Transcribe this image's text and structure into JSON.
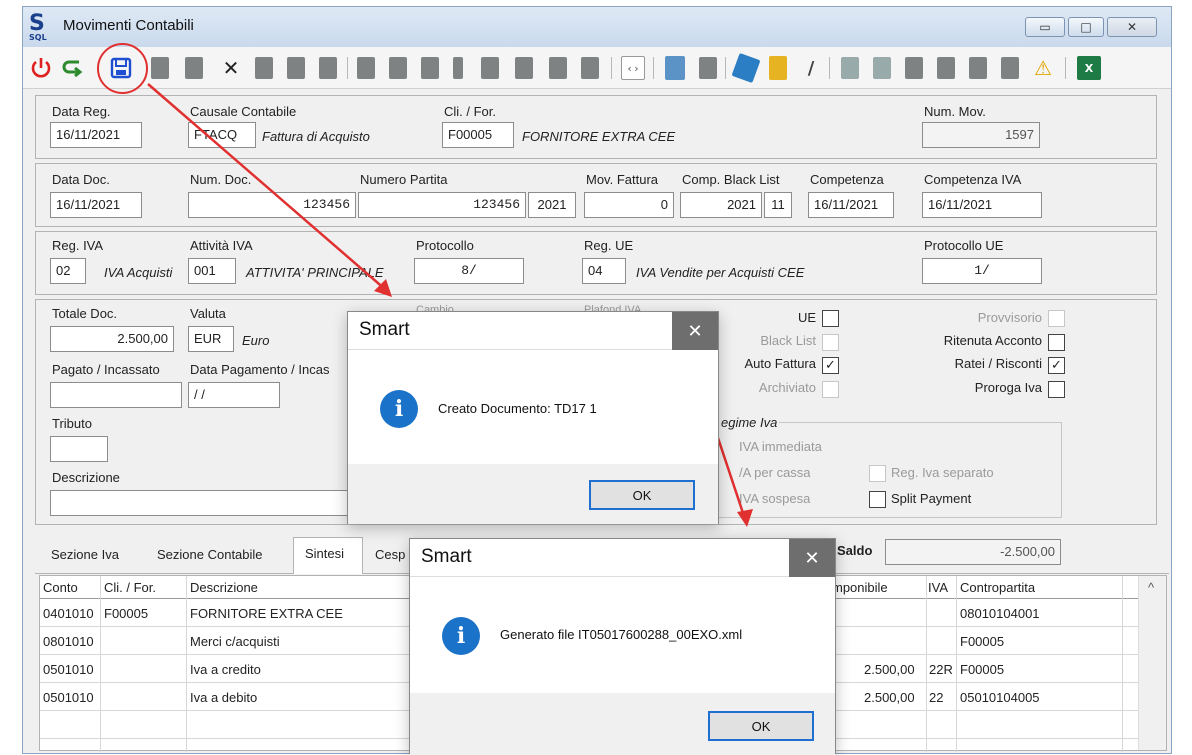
{
  "window": {
    "logo_letter": "S",
    "logo_sub": "SQL",
    "title": "Movimenti Contabili",
    "minimize_glyph": "▭",
    "maximize_glyph": "□",
    "close_glyph": "✕"
  },
  "toolbar": {
    "power_icon": "power-icon",
    "exit_icon": "exit-icon",
    "save_icon": "save-icon",
    "delete_glyph": "✕",
    "warning_glyph": "⚠",
    "excel_icon": "excel-icon"
  },
  "header": {
    "data_reg_label": "Data Reg.",
    "data_reg_value": "16/11/2021",
    "causale_label": "Causale Contabile",
    "causale_code": "FTACQ",
    "causale_desc": "Fattura di Acquisto",
    "cli_for_label": "Cli. / For.",
    "cli_for_code": "F00005",
    "cli_for_name": "FORNITORE EXTRA CEE",
    "num_mov_label": "Num. Mov.",
    "num_mov_value": "1597"
  },
  "doc": {
    "data_doc_label": "Data Doc.",
    "data_doc_value": "16/11/2021",
    "num_doc_label": "Num. Doc.",
    "num_doc_value": "123456",
    "num_partita_label": "Numero Partita",
    "num_partita_value": "123456",
    "num_partita_year": "2021",
    "mov_fattura_label": "Mov. Fattura",
    "mov_fattura_value": "0",
    "black_list_label": "Comp. Black List",
    "black_list_year": "2021",
    "black_list_month": "11",
    "competenza_label": "Competenza",
    "competenza_value": "16/11/2021",
    "competenza_iva_label": "Competenza IVA",
    "competenza_iva_value": "16/11/2021"
  },
  "iva": {
    "reg_iva_label": "Reg. IVA",
    "reg_iva_code": "02",
    "reg_iva_desc": "IVA Acquisti",
    "attivita_label": "Attività IVA",
    "attivita_code": "001",
    "attivita_desc": "ATTIVITA' PRINCIPALE",
    "protocollo_label": "Protocollo",
    "protocollo_value": "8/",
    "reg_ue_label": "Reg. UE",
    "reg_ue_code": "04",
    "reg_ue_desc": "IVA Vendite per Acquisti CEE",
    "protocollo_ue_label": "Protocollo UE",
    "protocollo_ue_value": "1/"
  },
  "totals": {
    "totale_doc_label": "Totale Doc.",
    "totale_doc_value": "2.500,00",
    "valuta_label": "Valuta",
    "valuta_code": "EUR",
    "valuta_desc": "Euro",
    "cambio_label": "Cambio",
    "plafond_label": "Plafond IVA",
    "pagato_label": "Pagato / Incassato",
    "data_pagamento_label": "Data Pagamento / Incas",
    "data_pagamento_value": "/ /",
    "tributo_label": "Tributo",
    "descrizione_label": "Descrizione",
    "regime_label": "egime Iva",
    "regime_immediata": "IVA immediata",
    "regime_cassa": "/A per cassa",
    "regime_sospesa": "IVA sospesa",
    "reg_iva_separato": "Reg. Iva separato",
    "split_payment": "Split Payment"
  },
  "flags": {
    "ue": "UE",
    "black_list": "Black List",
    "auto_fattura": "Auto Fattura",
    "archiviato": "Archiviato",
    "provvisorio": "Provvisorio",
    "ritenuta": "Ritenuta Acconto",
    "ratei": "Ratei / Risconti",
    "proroga": "Proroga Iva",
    "check_glyph": "✓"
  },
  "tabs": {
    "sezione_iva": "Sezione Iva",
    "sezione_contabile": "Sezione Contabile",
    "sintesi": "Sintesi",
    "cesp": "Cesp",
    "saldo_label": "Saldo",
    "saldo_value": "-2.500,00"
  },
  "grid": {
    "headers": {
      "conto": "Conto",
      "cli_for": "Cli. / For.",
      "descrizione": "Descrizione",
      "imponibile": "mponibile",
      "iva": "IVA",
      "contropartita": "Contropartita"
    },
    "rows": [
      {
        "conto": "0401010",
        "cli_for": "F00005",
        "descrizione": "FORNITORE EXTRA CEE",
        "imponibile": "",
        "iva": "",
        "contropartita": "08010104001"
      },
      {
        "conto": "0801010",
        "cli_for": "",
        "descrizione": "Merci c/acquisti",
        "imponibile": "",
        "iva": "",
        "contropartita": "F00005"
      },
      {
        "conto": "0501010",
        "cli_for": "",
        "descrizione": "Iva a credito",
        "imponibile": "2.500,00",
        "iva": "22R",
        "contropartita": "F00005"
      },
      {
        "conto": "0501010",
        "cli_for": "",
        "descrizione": "Iva a debito",
        "imponibile": "2.500,00",
        "iva": "22",
        "contropartita": "05010104005"
      }
    ],
    "scroll_up_glyph": "^"
  },
  "dialog1": {
    "title": "Smart",
    "close_glyph": "✕",
    "icon_glyph": "i",
    "message": "Creato Documento: TD17 1",
    "ok": "OK"
  },
  "dialog2": {
    "title": "Smart",
    "close_glyph": "✕",
    "icon_glyph": "i",
    "message": "Generato file  IT05017600288_00EXO.xml",
    "ok": "OK"
  },
  "colors": {
    "annotation_red": "#e03030",
    "info_blue": "#1a73c8",
    "focus_blue": "#1f6fd1",
    "dialog_close_bg": "#6e6e6e"
  }
}
